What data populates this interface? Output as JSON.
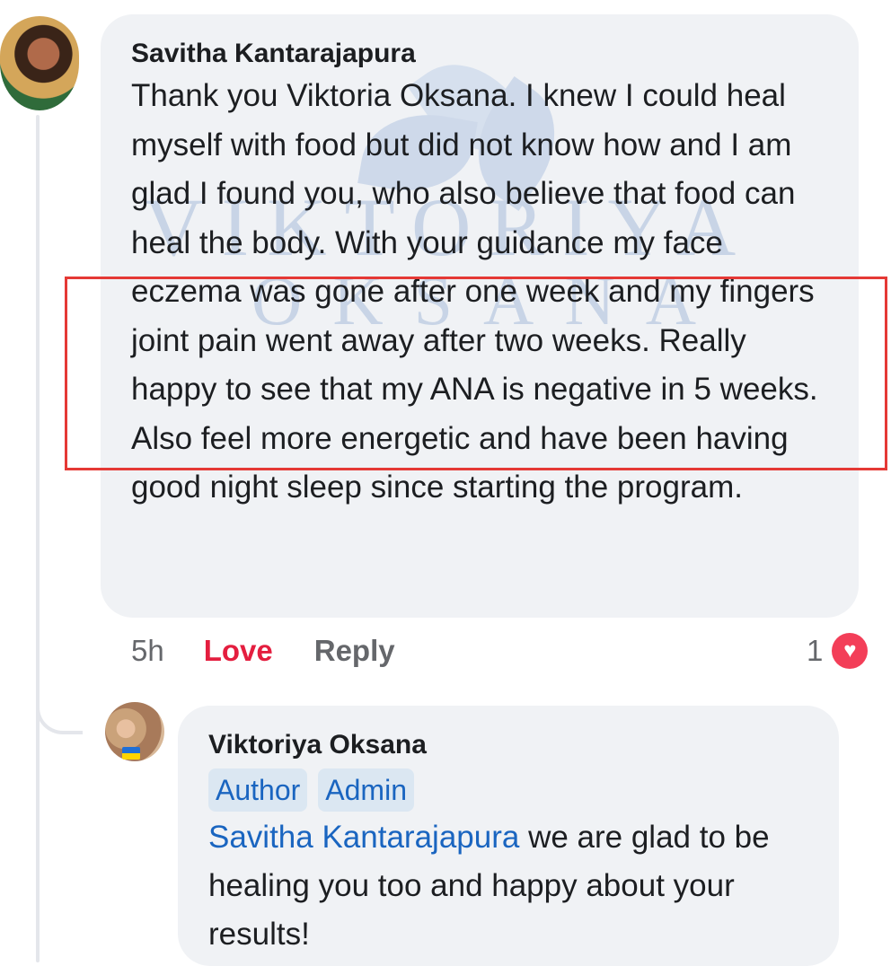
{
  "comment": {
    "author": "Savitha Kantarajapura",
    "text": "Thank you Viktoria Oksana. I knew I could heal myself with food but did not know how and I am glad I found you, who also believe that food can heal the body. With your guidance my face eczema was gone after one week and my fingers joint pain went away after two weeks. Really happy to see that my ANA is negative in 5 weeks. Also feel more energetic and have been having good night sleep since starting the program.",
    "time": "5h",
    "love_label": "Love",
    "reply_label": "Reply",
    "reaction_count": "1",
    "reaction_icon": "heart-icon"
  },
  "watermark": {
    "line1": "VIKTORIYA",
    "line2": "OKSANA"
  },
  "reply": {
    "author": "Viktoriya Oksana",
    "badges": [
      "Author",
      "Admin"
    ],
    "mention": "Savitha Kantarajapura",
    "text": " we are glad to be healing you too and happy about your results!"
  },
  "colors": {
    "bubble": "#f0f2f5",
    "love": "#e41e3f",
    "link": "#1a65c0",
    "highlight": "#e53935"
  }
}
